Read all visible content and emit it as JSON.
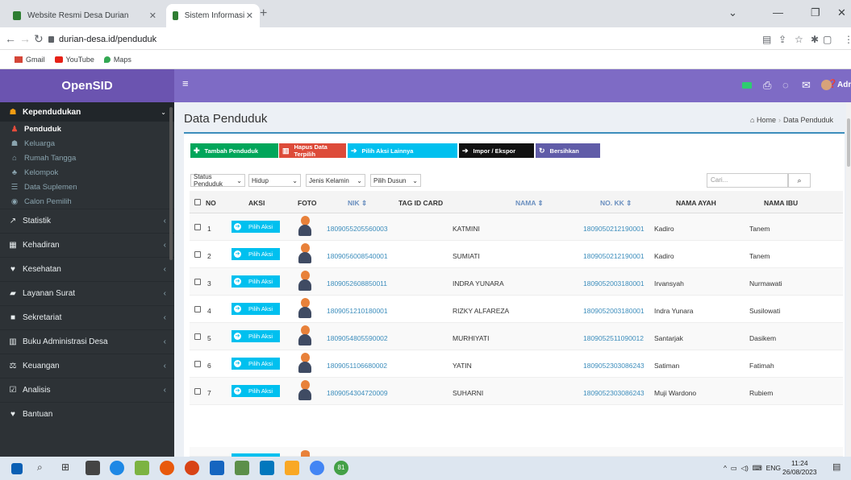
{
  "browser": {
    "tabs": [
      {
        "title": "Website Resmi Desa Durian",
        "active": false
      },
      {
        "title": "Sistem Informasi Desa Durian - P",
        "active": true
      }
    ],
    "url": "durian-desa.id/penduduk",
    "bookmarks": [
      "Gmail",
      "YouTube",
      "Maps"
    ]
  },
  "app": {
    "brand": "OpenSID",
    "user": "Administrator",
    "colors": {
      "header": "#7e6bc5",
      "brand": "#6b54b0",
      "sidebar": "#2d3236",
      "accent": "#3c8dbc"
    }
  },
  "sidebar": {
    "section": "Kependudukan",
    "subitems": [
      "Penduduk",
      "Keluarga",
      "Rumah Tangga",
      "Kelompok",
      "Data Suplemen",
      "Calon Pemilih"
    ],
    "items": [
      "Statistik",
      "Kehadiran",
      "Kesehatan",
      "Layanan Surat",
      "Sekretariat",
      "Buku Administrasi Desa",
      "Keuangan",
      "Analisis",
      "Bantuan"
    ]
  },
  "page": {
    "title": "Data Penduduk",
    "breadcrumb": {
      "home": "Home",
      "current": "Data Penduduk"
    }
  },
  "toolbar": {
    "tambah": "Tambah Penduduk",
    "hapus": "Hapus Data Terpilih",
    "pilih": "Pilih Aksi Lainnya",
    "impor": "Impor / Ekspor",
    "bersihkan": "Bersihkan"
  },
  "filters": {
    "status": "Status Penduduk",
    "hidup": "Hidup",
    "jenis_kelamin": "Jenis Kelamin",
    "dusun": "Pilih Dusun",
    "search_placeholder": "Cari..."
  },
  "table": {
    "headers": {
      "no": "NO",
      "aksi": "AKSI",
      "foto": "FOTO",
      "nik": "NIK ⇕",
      "tag": "TAG ID CARD",
      "nama": "NAMA ⇕",
      "nokk": "NO. KK ⇕",
      "ayah": "NAMA AYAH",
      "ibu": "NAMA IBU"
    },
    "action_label": "Pilih Aksi",
    "rows": [
      {
        "no": "1",
        "nik": "1809055205560003",
        "nama": "KATMINI",
        "kk": "1809050212190001",
        "ayah": "Kadiro",
        "ibu": "Tanem"
      },
      {
        "no": "2",
        "nik": "1809056008540001",
        "nama": "SUMIATI",
        "kk": "1809050212190001",
        "ayah": "Kadiro",
        "ibu": "Tanem"
      },
      {
        "no": "3",
        "nik": "1809052608850011",
        "nama": "INDRA YUNARA",
        "kk": "1809052003180001",
        "ayah": "Irvansyah",
        "ibu": "Nurmawati"
      },
      {
        "no": "4",
        "nik": "1809051210180001",
        "nama": "RIZKY ALFAREZA",
        "kk": "1809052003180001",
        "ayah": "Indra Yunara",
        "ibu": "Susilowati"
      },
      {
        "no": "5",
        "nik": "1809054805590002",
        "nama": "MURHIYATI",
        "kk": "1809052511090012",
        "ayah": "Santarjak",
        "ibu": "Dasikem"
      },
      {
        "no": "6",
        "nik": "1809051106680002",
        "nama": "YATIN",
        "kk": "1809052303086243",
        "ayah": "Satiman",
        "ibu": "Fatimah"
      },
      {
        "no": "7",
        "nik": "1809054304720009",
        "nama": "SUHARNI",
        "kk": "1809052303086243",
        "ayah": "Muji Wardono",
        "ibu": "Rubiem"
      }
    ]
  },
  "taskbar": {
    "lang": "ENG",
    "time": "11:24",
    "date": "26/08/2023",
    "badge": "81"
  }
}
